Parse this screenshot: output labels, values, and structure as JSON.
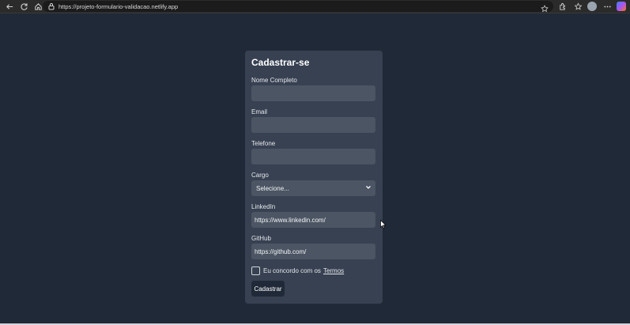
{
  "browser": {
    "url": "https://projeto-formulario-validacao.netlify.app"
  },
  "form": {
    "title": "Cadastrar-se",
    "name_label": "Nome Completo",
    "name_value": "",
    "email_label": "Email",
    "email_value": "",
    "phone_label": "Telefone",
    "phone_value": "",
    "role_label": "Cargo",
    "role_selected": "Selecione...",
    "linkedin_label": "LinkedIn",
    "linkedin_value": "https://www.linkedin.com/",
    "github_label": "GitHub",
    "github_value": "https://github.com/",
    "terms_text": "Eu concordo com os",
    "terms_link": "Termos",
    "terms_checked": false,
    "submit_label": "Cadastrar"
  },
  "colors": {
    "page_bg": "#1f2937",
    "card_bg": "#374151",
    "field_bg": "#4b5563",
    "button_bg": "#1f2937"
  }
}
